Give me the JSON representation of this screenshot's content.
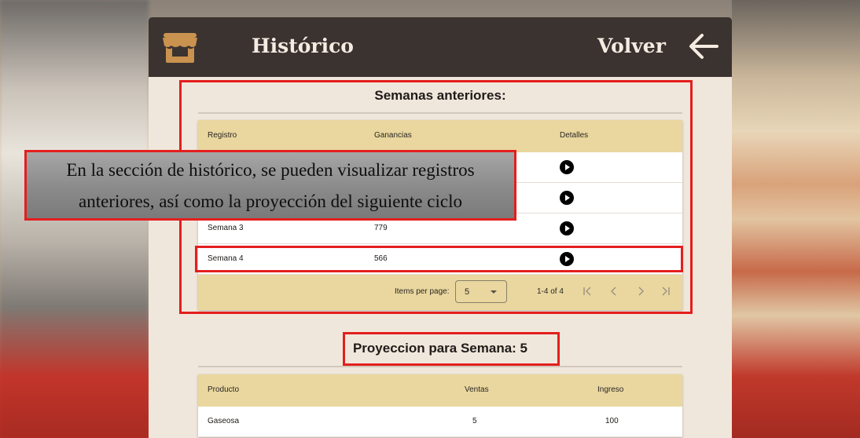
{
  "header": {
    "title": "Histórico",
    "back_label": "Volver",
    "store_icon": "store-awning-icon",
    "back_icon": "arrow-left-icon"
  },
  "history": {
    "section_title": "Semanas anteriores:",
    "columns": [
      "Registro",
      "Ganancias",
      "Detalles"
    ],
    "rows": [
      {
        "registro": "Semana 3",
        "ganancias": "779"
      },
      {
        "registro": "Semana 4",
        "ganancias": "566"
      }
    ],
    "paginator": {
      "items_per_page_label": "Items per page:",
      "page_size": "5",
      "range_label": "1-4 of 4"
    }
  },
  "projection": {
    "section_title": "Proyeccion para Semana: 5",
    "columns": [
      "Producto",
      "Ventas",
      "Ingreso"
    ],
    "rows": [
      {
        "producto": "Gaseosa",
        "ventas": "5",
        "ingreso": "100"
      }
    ]
  },
  "callout": {
    "line1": "En la sección de histórico, se pueden visualizar registros",
    "line2": "anteriores, así como la proyección del siguiente ciclo"
  },
  "colors": {
    "header_bg": "#3b3330",
    "table_header_bg": "#e9d79f",
    "highlight_red": "#e41e1e",
    "panel_bg": "#f0e7dc"
  }
}
